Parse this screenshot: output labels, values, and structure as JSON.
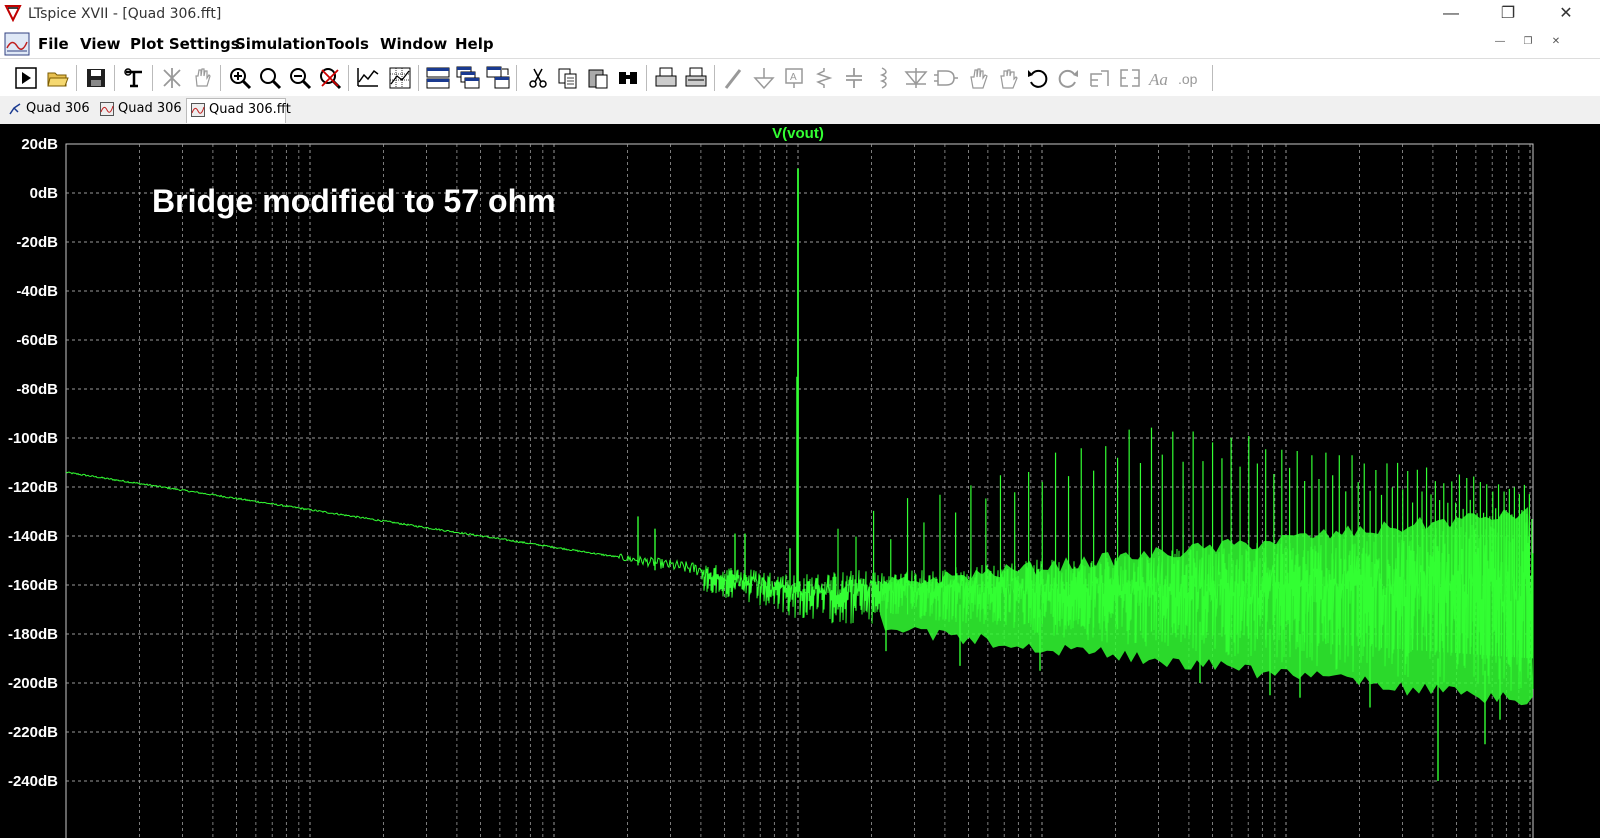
{
  "window": {
    "title": "LTspice XVII - [Quad 306.fft]",
    "controls": [
      "minimize",
      "restore",
      "close"
    ]
  },
  "menu": {
    "items": [
      "File",
      "View",
      "Plot Settings",
      "Simulation",
      "Tools",
      "Window",
      "Help"
    ]
  },
  "toolbar": {
    "icons": [
      "run-icon",
      "open-icon",
      "save-icon",
      "control-panel-icon",
      "halt-icon",
      "pan-icon",
      "zoom-in-icon",
      "zoom-box-icon",
      "zoom-out-icon",
      "zoom-fit-icon",
      "autorange-icon",
      "grid-icon",
      "tile-horizontal-icon",
      "cascade-icon",
      "tile-vertical-icon",
      "cut-icon",
      "copy-icon",
      "paste-icon",
      "find-icon",
      "print-icon",
      "print-preview-icon",
      "wire-icon",
      "ground-icon",
      "label-icon",
      "resistor-icon",
      "capacitor-icon",
      "inductor-icon",
      "diode-icon",
      "component-icon",
      "move-icon",
      "drag-icon",
      "undo-icon",
      "redo-icon",
      "rotate-icon",
      "mirror-icon",
      "text-icon",
      "spice-directive-icon"
    ]
  },
  "tabs": [
    {
      "label": "Quad 306",
      "icon": "schematic-icon",
      "active": false
    },
    {
      "label": "Quad 306",
      "icon": "waveform-icon",
      "active": false
    },
    {
      "label": "Quad 306.fft",
      "icon": "waveform-icon",
      "active": true
    }
  ],
  "plot": {
    "trace_label": "V(vout)",
    "annotation": "Bridge modified to 57 ohm",
    "trace_color": "#33ff33",
    "grid_color": "#9a9a9a",
    "background": "#000000"
  },
  "chart_data": {
    "type": "line",
    "title": "",
    "series": [
      {
        "name": "V(vout)",
        "color": "#33ff33"
      }
    ],
    "ylabel": "",
    "xlabel": "",
    "y_ticks": [
      "20dB",
      "0dB",
      "-20dB",
      "-40dB",
      "-60dB",
      "-80dB",
      "-100dB",
      "-120dB",
      "-140dB",
      "-160dB",
      "-180dB",
      "-200dB",
      "-220dB",
      "-240dB"
    ],
    "ylim": [
      -255,
      20
    ],
    "x_scale": "log",
    "grid": true,
    "noise_floor": {
      "start_db": -114,
      "knee_db": -160,
      "end_floor_db": -200
    },
    "peaks": [
      {
        "x": 0.5,
        "db": 10
      },
      {
        "x": 0.0,
        "db": -74
      }
    ],
    "harmonics_envelope_db": [
      -92,
      -95,
      -100,
      -112,
      -122
    ]
  }
}
